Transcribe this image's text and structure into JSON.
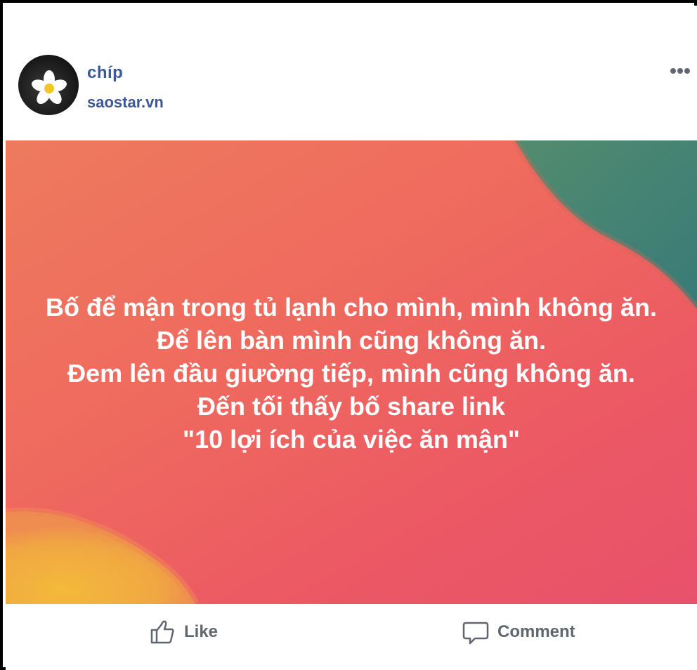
{
  "post": {
    "author": {
      "name": "chíp",
      "subtitle": "saostar.vn",
      "avatar_icon": "frangipani-flower-icon"
    },
    "more_icon": "more-options-icon",
    "image": {
      "lines": [
        "Bố để mận trong tủ lạnh cho mình, mình không ăn.",
        "Để lên bàn mình cũng không ăn.",
        "Đem lên đầu giường tiếp, mình cũng không ăn.",
        "Đến tối thấy bố share link",
        "\"10 lợi ích của việc ăn mận\""
      ],
      "colors": {
        "background": "#ef6a5e",
        "teal_blob": "#3f8a78",
        "yellow_blob": "#f2b63c",
        "text": "#ffffff"
      }
    },
    "actions": {
      "like_label": "Like",
      "like_icon": "thumbs-up-icon",
      "comment_label": "Comment",
      "comment_icon": "comment-bubble-icon"
    },
    "link_color": "#3b5998"
  }
}
